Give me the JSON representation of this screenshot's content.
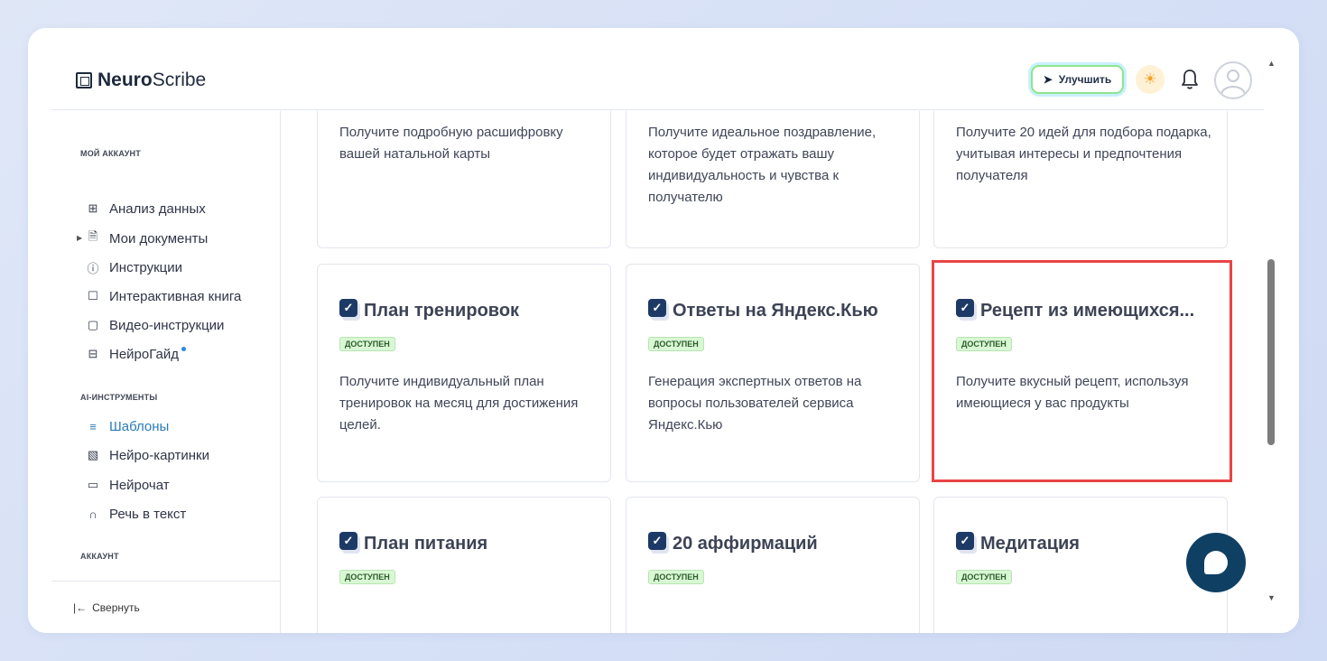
{
  "app": {
    "logo_bold": "Neuro",
    "logo_light": "Scribe"
  },
  "header": {
    "upgrade_label": "Улучшить"
  },
  "sidebar": {
    "section_account": "МОЙ АККАУНТ",
    "section_ai": "AI-ИНСТРУМЕНТЫ",
    "section_account2": "АККАУНТ",
    "items": [
      {
        "label": "Анализ данных",
        "icon": "grid-icon"
      },
      {
        "label": "Мои документы",
        "icon": "document-icon"
      },
      {
        "label": "Инструкции",
        "icon": "help-circle-icon"
      },
      {
        "label": "Интерактивная книга",
        "icon": "book-icon"
      },
      {
        "label": "Видео-инструкции",
        "icon": "video-icon"
      },
      {
        "label": "НейроГайд",
        "icon": "guide-icon"
      },
      {
        "label": "Шаблоны",
        "icon": "layers-icon"
      },
      {
        "label": "Нейро-картинки",
        "icon": "image-icon"
      },
      {
        "label": "Нейрочат",
        "icon": "chat-icon"
      },
      {
        "label": "Речь в текст",
        "icon": "headphones-icon"
      }
    ],
    "collapse_label": "Свернуть"
  },
  "cards": {
    "row0": [
      {
        "desc": "Получите подробную расшифровку вашей натальной карты"
      },
      {
        "desc": "Получите идеальное поздравление, которое будет отражать вашу индивидуальность и чувства к получателю"
      },
      {
        "desc": "Получите 20 идей для подбора подарка, учитывая интересы и предпочтения получателя"
      }
    ],
    "row1": [
      {
        "title": "План тренировок",
        "badge": "ДОСТУПЕН",
        "desc": "Получите индивидуальный план тренировок на месяц для достижения целей."
      },
      {
        "title": "Ответы на Яндекс.Кью",
        "badge": "ДОСТУПЕН",
        "desc": "Генерация экспертных ответов на вопросы пользователей сервиса Яндекс.Кью"
      },
      {
        "title": "Рецепт из имеющихся...",
        "badge": "ДОСТУПЕН",
        "desc": "Получите вкусный рецепт, используя имеющиеся у вас продукты"
      }
    ],
    "row2": [
      {
        "title": "План питания",
        "badge": "ДОСТУПЕН"
      },
      {
        "title": "20 аффирмаций",
        "badge": "ДОСТУПЕН"
      },
      {
        "title": "Медитация",
        "badge": "ДОСТУПЕН"
      }
    ]
  }
}
